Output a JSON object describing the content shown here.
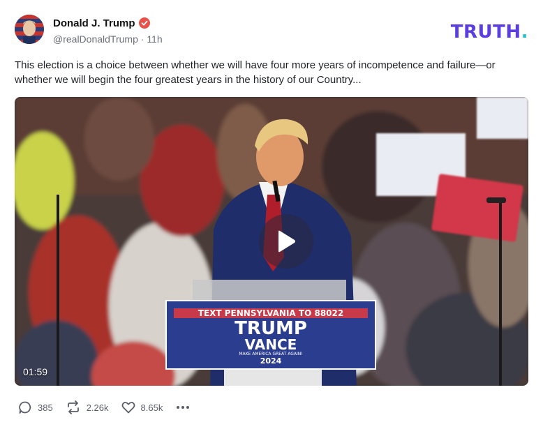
{
  "post": {
    "author_name": "Donald J. Trump",
    "handle": "@realDonaldTrump",
    "separator": "·",
    "time_ago": "11h",
    "text": "This election is a choice between whether we will have four more years of incompetence and failure—or whether we will begin the four greatest years in the history of our Country...",
    "verified_icon": "verified-badge-icon",
    "verified_color": "#e8504a"
  },
  "brand": {
    "logo_text": "TRUTH",
    "logo_dot": ".",
    "primary_color": "#5b3ee0",
    "accent_color": "#23c4c8"
  },
  "media": {
    "duration": "01:59",
    "play_icon": "play-icon",
    "podium_signs": {
      "line1": "TEXT PENNSYLVANIA TO 88022",
      "line2": "TRUMP",
      "line3": "VANCE",
      "line4": "MAKE AMERICA GREAT AGAIN!",
      "line5": "2024"
    }
  },
  "actions": {
    "replies": "385",
    "retruths": "2.26k",
    "likes": "8.65k",
    "icons": [
      "reply-icon",
      "retruth-icon",
      "like-icon",
      "more-icon"
    ]
  }
}
